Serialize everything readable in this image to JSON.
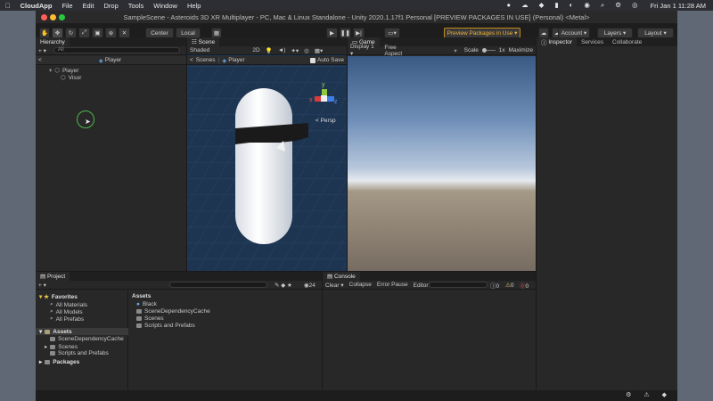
{
  "menubar": {
    "apple": "",
    "app": "CloudApp",
    "items": [
      "File",
      "Edit",
      "Drop",
      "Tools",
      "Window",
      "Help"
    ],
    "datetime": "Fri Jan 1  11:28 AM"
  },
  "window": {
    "title": "SampleScene - Asteroids 3D XR Multiplayer - PC, Mac & Linux Standalone - Unity 2020.1.17f1 Personal [PREVIEW PACKAGES IN USE] (Personal) <Metal>"
  },
  "toolbar": {
    "pivot": "Center",
    "space": "Local",
    "preview": "Preview Packages in Use",
    "account": "Account",
    "layers": "Layers",
    "layout": "Layout"
  },
  "hierarchy": {
    "tab": "Hierarchy",
    "search_placeholder": "All",
    "breadcrumb": "Player",
    "items": [
      {
        "label": "Player"
      },
      {
        "label": "Visor"
      }
    ]
  },
  "scene": {
    "tab": "Scene",
    "shading": "Shaded",
    "mode2d": "2D",
    "breadcrumb_root": "Scenes",
    "breadcrumb_leaf": "Player",
    "autosave": "Auto Save",
    "persp": "< Persp",
    "axes": {
      "y": "y",
      "x": "x",
      "z": "z"
    }
  },
  "game": {
    "tab": "Game",
    "display": "Display 1",
    "aspect": "Free Aspect",
    "scale_label": "Scale",
    "scale_value": "1x",
    "maximize": "Maximize"
  },
  "right_tabs": {
    "inspector": "Inspector",
    "services": "Services",
    "collaborate": "Collaborate"
  },
  "project": {
    "tab": "Project",
    "count": "24",
    "favorites": "Favorites",
    "fav_items": [
      "All Materials",
      "All Models",
      "All Prefabs"
    ],
    "assets": "Assets",
    "asset_tree": [
      "SceneDependencyCache",
      "Scenes",
      "Scripts and Prefabs"
    ],
    "packages": "Packages",
    "content_header": "Assets",
    "content_items": [
      "Black",
      "SceneDependencyCache",
      "Scenes",
      "Scripts and Prefabs"
    ]
  },
  "console": {
    "tab": "Console",
    "clear": "Clear",
    "collapse": "Collapse",
    "error_pause": "Error Pause",
    "editor": "Editor",
    "counts": [
      "0",
      "0",
      "0"
    ]
  }
}
